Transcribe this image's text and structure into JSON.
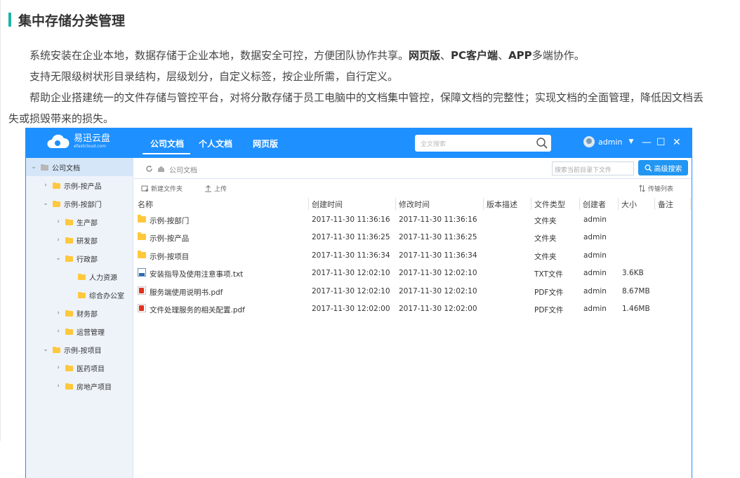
{
  "article": {
    "title": "集中存储分类管理",
    "p1_text": "系统安装在企业本地，数据存储于企业本地，数据安全可控，方便团队协作共享。",
    "p1_bold1": "网页版",
    "p1_sep1": "、",
    "p1_bold2": "PC客户端",
    "p1_sep2": "、",
    "p1_bold3": "APP",
    "p1_tail": "多端协作。",
    "p2": "支持无限级树状形目录结构，层级划分，自定义标签，按企业所需，自行定义。",
    "p3": "帮助企业搭建统一的文件存储与管控平台，对将分散存储于员工电脑中的文档集中管控，保障文档的完整性；实现文档的全面管理，降低因文档丢失或损毁带来的损失。"
  },
  "app": {
    "brand_name": "易迅云盘",
    "brand_domain": "efastcloud.com",
    "nav": [
      "公司文档",
      "个人文档",
      "网页版"
    ],
    "search_placeholder": "全文搜索",
    "user_name": "admin",
    "window_controls": [
      "—",
      "☐",
      "✕"
    ]
  },
  "sidebar": {
    "items": [
      {
        "label": "公司文档",
        "toggle": "⌄"
      },
      {
        "label": "示例-按产品",
        "toggle": "›"
      },
      {
        "label": "示例-按部门",
        "toggle": "⌄"
      },
      {
        "label": "生产部",
        "toggle": "›"
      },
      {
        "label": "研发部",
        "toggle": "›"
      },
      {
        "label": "行政部",
        "toggle": "⌄"
      },
      {
        "label": "人力资源",
        "toggle": ""
      },
      {
        "label": "综合办公室",
        "toggle": ""
      },
      {
        "label": "财务部",
        "toggle": "›"
      },
      {
        "label": "运营管理",
        "toggle": "›"
      },
      {
        "label": "示例-按项目",
        "toggle": "⌄"
      },
      {
        "label": "医药项目",
        "toggle": "›"
      },
      {
        "label": "房地产项目",
        "toggle": "›"
      }
    ]
  },
  "content": {
    "breadcrumb": "公司文档",
    "dir_search_placeholder": "搜索当前目录下文件",
    "advanced_search": "高级搜索",
    "new_folder": "新建文件夹",
    "upload": "上传",
    "transfer_list": "传输列表",
    "columns": [
      "名称",
      "创建时间",
      "修改时间",
      "版本描述",
      "文件类型",
      "创建者",
      "大小",
      "备注"
    ],
    "rows": [
      {
        "icon": "folder",
        "name": "示例-按部门",
        "created": "2017-11-30 11:36:16",
        "modified": "2017-11-30 11:36:16",
        "version": "",
        "type": "文件夹",
        "creator": "admin",
        "size": "",
        "note": ""
      },
      {
        "icon": "folder",
        "name": "示例-按产品",
        "created": "2017-11-30 11:36:25",
        "modified": "2017-11-30 11:36:25",
        "version": "",
        "type": "文件夹",
        "creator": "admin",
        "size": "",
        "note": ""
      },
      {
        "icon": "folder",
        "name": "示例-按项目",
        "created": "2017-11-30 11:36:34",
        "modified": "2017-11-30 11:36:34",
        "version": "",
        "type": "文件夹",
        "creator": "admin",
        "size": "",
        "note": ""
      },
      {
        "icon": "txt",
        "name": "安装指导及使用注意事项.txt",
        "created": "2017-11-30 12:02:10",
        "modified": "2017-11-30 12:02:10",
        "version": "",
        "type": "TXT文件",
        "creator": "admin",
        "size": "3.6KB",
        "note": ""
      },
      {
        "icon": "pdf",
        "name": "服务端使用说明书.pdf",
        "created": "2017-11-30 12:02:10",
        "modified": "2017-11-30 12:02:10",
        "version": "",
        "type": "PDF文件",
        "creator": "admin",
        "size": "8.67MB",
        "note": ""
      },
      {
        "icon": "pdf",
        "name": "文件处理服务的相关配置.pdf",
        "created": "2017-11-30 12:02:00",
        "modified": "2017-11-30 12:02:00",
        "version": "",
        "type": "PDF文件",
        "creator": "admin",
        "size": "1.46MB",
        "note": ""
      }
    ]
  },
  "colors": {
    "accent": "#1e90ff",
    "title_bar": "#1fb3a6",
    "folder": "#ffc83d"
  }
}
